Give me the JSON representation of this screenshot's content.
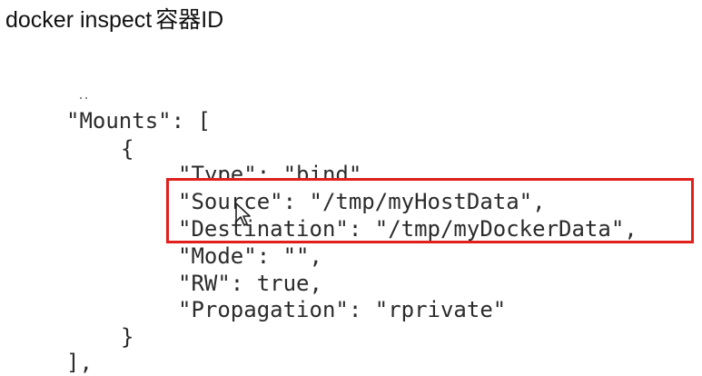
{
  "heading": {
    "command": "docker inspect",
    "argument": "容器ID"
  },
  "code": {
    "line0": "\"Mounts\": [",
    "line1": "{",
    "line2": "\"Type\": \"bind\",",
    "line3": "\"Source\": \"/tmp/myHostData\",",
    "line4": "\"Destination\": \"/tmp/myDockerData\",",
    "line5": "\"Mode\": \"\",",
    "line6": "\"RW\": true,",
    "line7": "\"Propagation\": \"rprivate\"",
    "line8": "}",
    "line9": "],"
  },
  "colors": {
    "highlight_border": "#e0201c",
    "text": "#2b2b2b"
  },
  "icons": {
    "cursor": "mouse-pointer-icon"
  }
}
